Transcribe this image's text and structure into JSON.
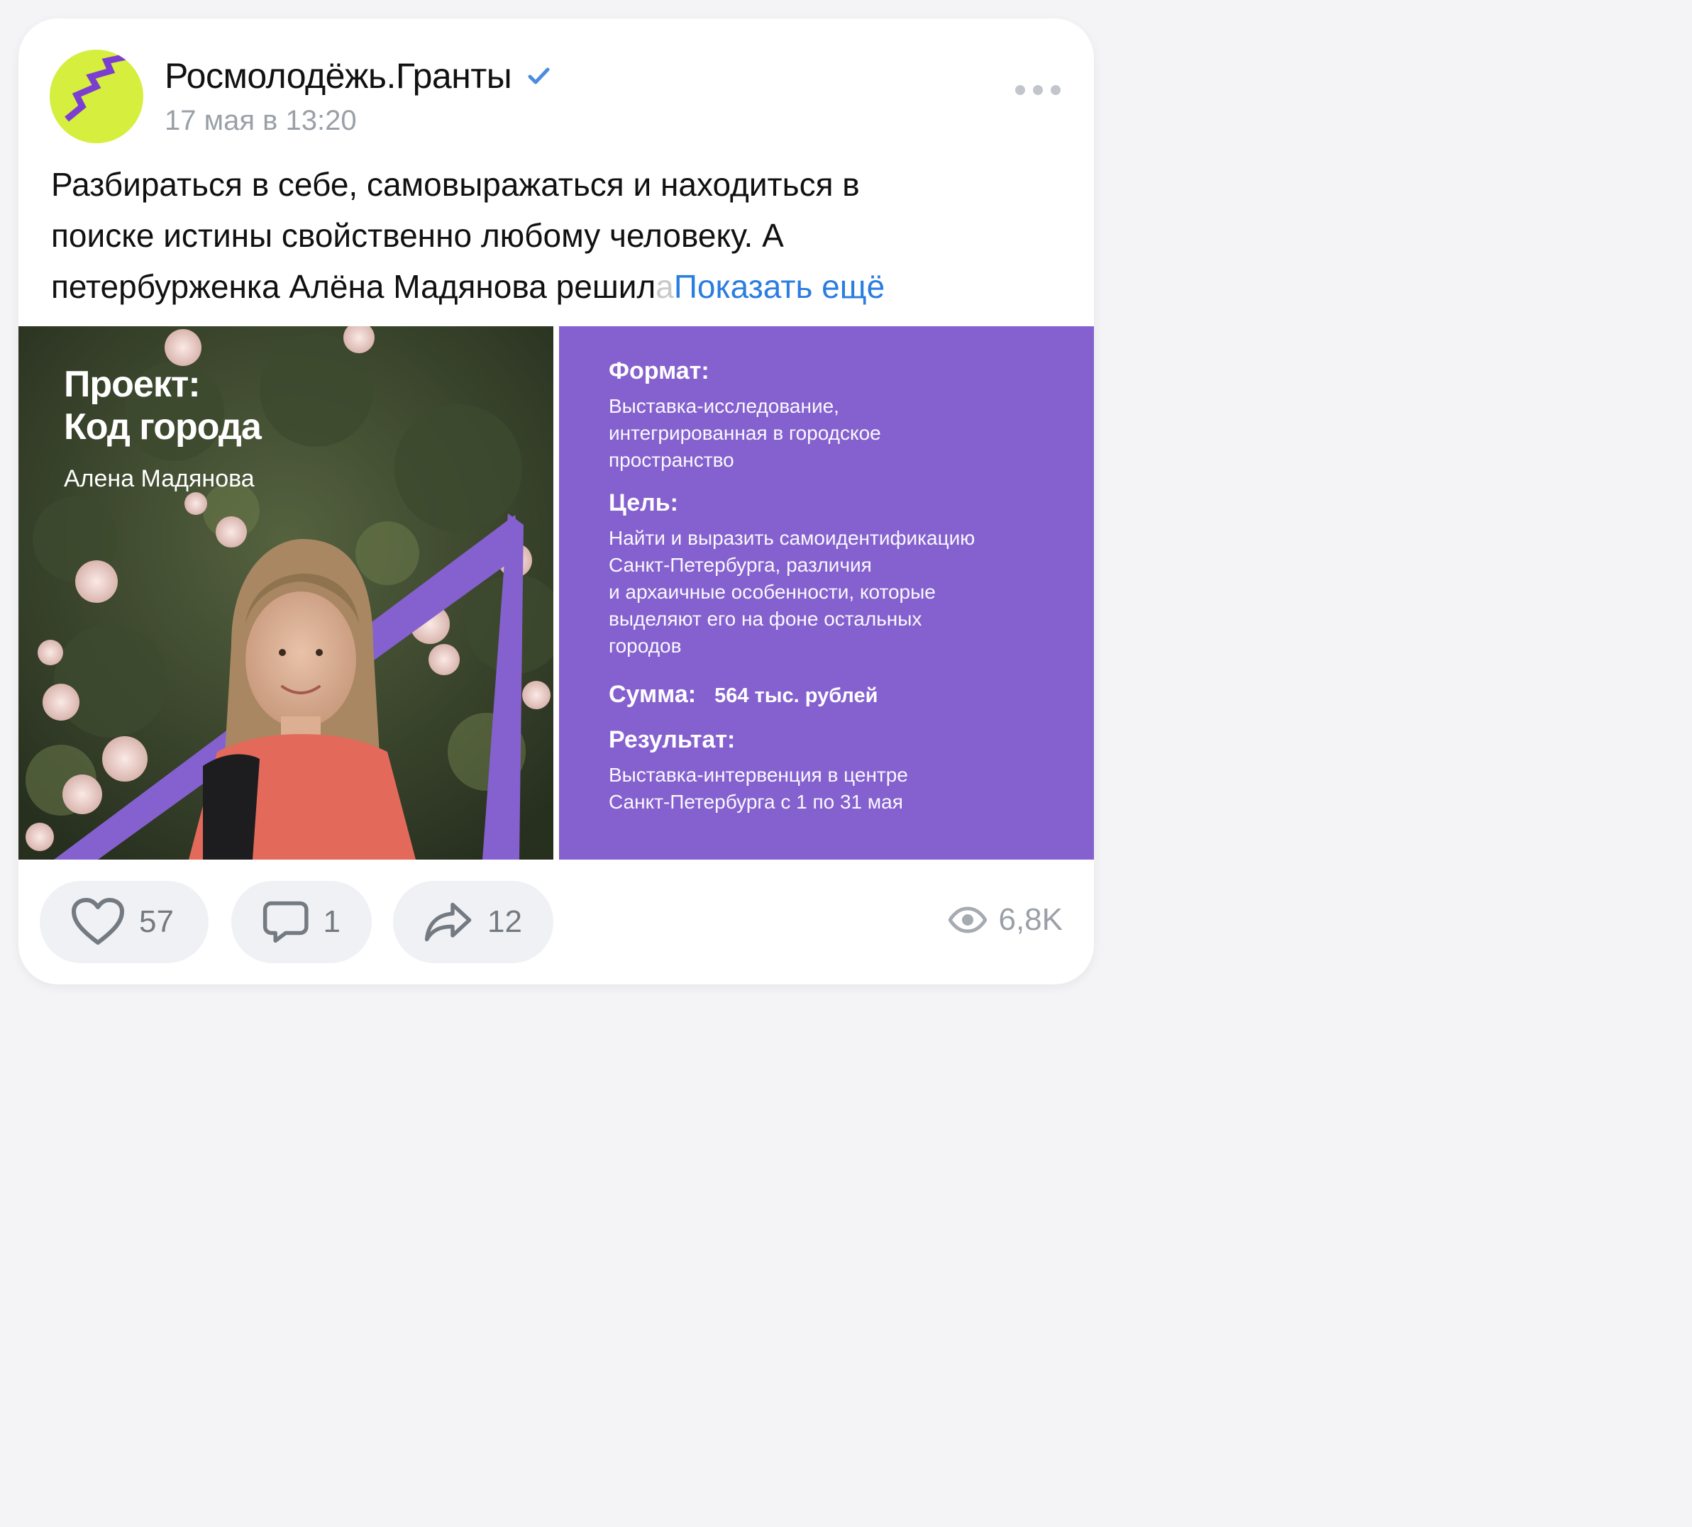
{
  "post": {
    "author": "Росмолодёжь.Гранты",
    "date": "17 мая в 13:20",
    "text_lines": [
      "Разбираться в себе, самовыражаться и находиться в",
      "поиске истины свойственно любому человеку. А",
      "петербурженка Алёна Мадянова решил"
    ],
    "text_faded": "а",
    "show_more": "Показать ещё"
  },
  "image_left": {
    "title_line1": "Проект:",
    "title_line2": "Код города",
    "subtitle": "Алена Мадянова"
  },
  "image_right": {
    "format_label": "Формат:",
    "format_lines": [
      "Выставка-исследование,",
      "интегрированная в городское",
      "пространство"
    ],
    "goal_label": "Цель:",
    "goal_lines": [
      "Найти и выразить самоидентификацию",
      "Санкт-Петербурга, различия",
      "и архаичные особенности, которые",
      "выделяют его на фоне остальных",
      "городов"
    ],
    "sum_label": "Сумма:",
    "sum_value": "564 тыс. рублей",
    "result_label": "Результат:",
    "result_lines": [
      "Выставка-интервенция в центре",
      "Санкт-Петербурга с 1 по 31 мая"
    ]
  },
  "actions": {
    "likes": "57",
    "comments": "1",
    "shares": "12",
    "views": "6,8K"
  },
  "colors": {
    "accent_link": "#2a7de1",
    "purple": "#8561cf",
    "avatar_bg": "#d6ee3e"
  }
}
